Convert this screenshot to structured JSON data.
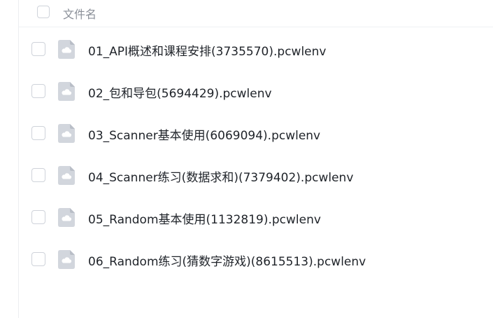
{
  "header": {
    "column_label": "文件名"
  },
  "files": [
    {
      "name": "01_API概述和课程安排(3735570).pcwlenv",
      "icon": "cloud-file-icon"
    },
    {
      "name": "02_包和导包(5694429).pcwlenv",
      "icon": "cloud-file-icon"
    },
    {
      "name": "03_Scanner基本使用(6069094).pcwlenv",
      "icon": "cloud-file-icon"
    },
    {
      "name": "04_Scanner练习(数据求和)(7379402).pcwlenv",
      "icon": "cloud-file-icon"
    },
    {
      "name": "05_Random基本使用(1132819).pcwlenv",
      "icon": "cloud-file-icon"
    },
    {
      "name": "06_Random练习(猜数字游戏)(8615513).pcwlenv",
      "icon": "cloud-file-icon"
    }
  ],
  "colors": {
    "icon_bg": "#d2d6dd",
    "checkbox_border": "#cfd3da",
    "text": "#1f2329",
    "header_text": "#8a8f98"
  }
}
